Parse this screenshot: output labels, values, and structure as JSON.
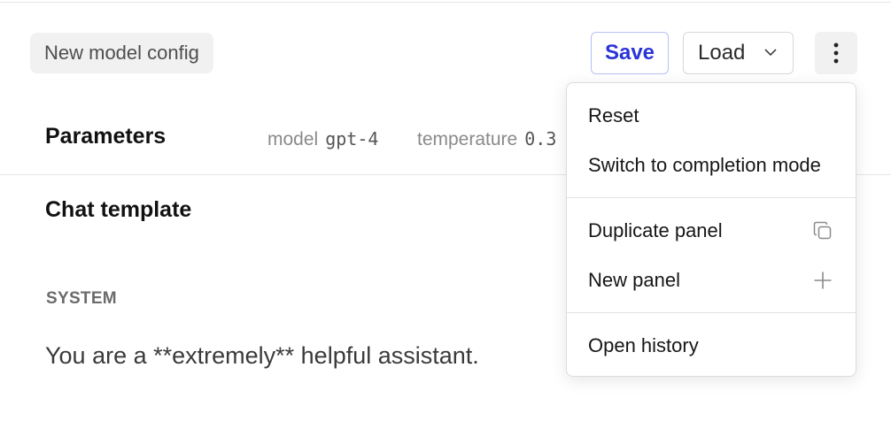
{
  "header": {
    "config_name": "New model config",
    "save_label": "Save",
    "load_label": "Load",
    "more_icon": "vertical-ellipsis-icon"
  },
  "parameters": {
    "title": "Parameters",
    "items": [
      {
        "label": "model",
        "value": "gpt-4"
      },
      {
        "label": "temperature",
        "value": "0.3"
      }
    ]
  },
  "chat_template": {
    "title": "Chat template",
    "messages": [
      {
        "role": "SYSTEM",
        "content": "You are a **extremely** helpful assistant."
      }
    ]
  },
  "menu": {
    "items": [
      {
        "label": "Reset"
      },
      {
        "label": "Switch to completion mode"
      },
      {
        "label": "Duplicate panel",
        "icon": "copy-icon"
      },
      {
        "label": "New panel",
        "icon": "plus-icon"
      },
      {
        "label": "Open history"
      }
    ]
  },
  "colors": {
    "accent": "#2b35d6",
    "save_border": "#b7bff5",
    "chip_bg": "#f1f1f1",
    "divider": "#e6e6e6"
  }
}
